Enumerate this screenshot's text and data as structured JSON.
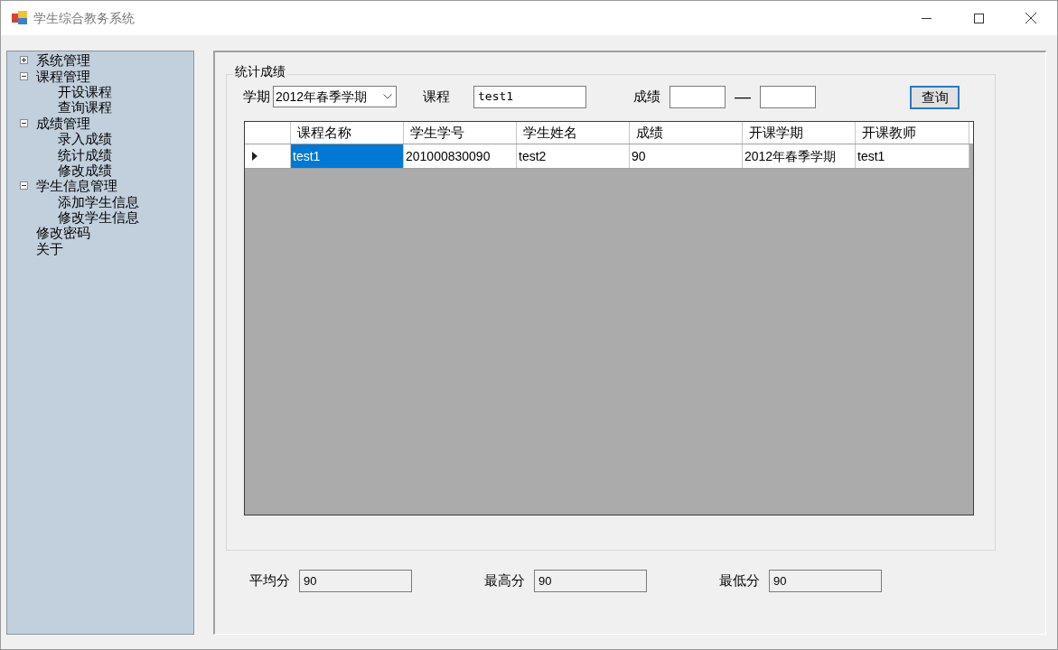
{
  "window": {
    "title": "学生综合教务系统"
  },
  "sidebar": {
    "tree": [
      {
        "label": "系统管理",
        "expanded": false
      },
      {
        "label": "课程管理",
        "expanded": true,
        "children": [
          {
            "label": "开设课程"
          },
          {
            "label": "查询课程"
          }
        ]
      },
      {
        "label": "成绩管理",
        "expanded": true,
        "children": [
          {
            "label": "录入成绩"
          },
          {
            "label": "统计成绩"
          },
          {
            "label": "修改成绩"
          }
        ]
      },
      {
        "label": "学生信息管理",
        "expanded": true,
        "children": [
          {
            "label": "添加学生信息"
          },
          {
            "label": "修改学生信息"
          }
        ]
      },
      {
        "label": "修改密码"
      },
      {
        "label": "关于"
      }
    ]
  },
  "group": {
    "title": "统计成绩",
    "filters": {
      "term_label": "学期",
      "term_value": "2012年春季学期",
      "course_label": "课程",
      "course_value": "test1",
      "score_label": "成绩",
      "range_dash": "—",
      "query_button": "查询"
    },
    "table": {
      "columns": [
        "课程名称",
        "学生学号",
        "学生姓名",
        "成绩",
        "开课学期",
        "开课教师"
      ],
      "rows": [
        {
          "current": true,
          "cells": [
            {
              "text": "test1",
              "selected": true
            },
            {
              "text": "201000830090",
              "selected": false
            },
            {
              "text": "test2",
              "selected": false
            },
            {
              "text": "90",
              "selected": false
            },
            {
              "text": "2012年春季学期",
              "selected": false
            },
            {
              "text": "test1",
              "selected": false
            }
          ]
        }
      ]
    }
  },
  "stats": [
    {
      "label": "平均分",
      "value": "90"
    },
    {
      "label": "最高分",
      "value": "90"
    },
    {
      "label": "最低分",
      "value": "90"
    }
  ]
}
